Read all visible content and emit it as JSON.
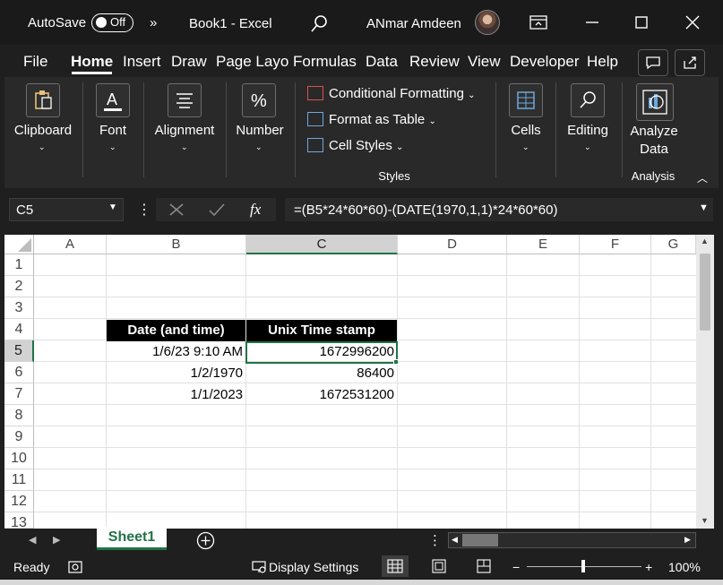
{
  "titlebar": {
    "autosave_label": "AutoSave",
    "autosave_state": "Off",
    "more_glyph": "»",
    "doc_title": "Book1  -  Excel",
    "user_name": "ANmar Amdeen"
  },
  "menu": {
    "tabs": [
      "File",
      "Home",
      "Insert",
      "Draw",
      "Page Layo",
      "Formulas",
      "Data",
      "Review",
      "View",
      "Developer",
      "Help"
    ],
    "active_tab": "Home"
  },
  "ribbon": {
    "clipboard": "Clipboard",
    "font": "Font",
    "alignment": "Alignment",
    "number": "Number",
    "cond_format": "Conditional Formatting",
    "format_table": "Format as Table",
    "cell_styles": "Cell Styles",
    "styles_group": "Styles",
    "cells": "Cells",
    "editing": "Editing",
    "analyze_1": "Analyze",
    "analyze_2": "Data",
    "analysis_group": "Analysis"
  },
  "formula_bar": {
    "name_box": "C5",
    "fx": "fx",
    "formula": "=(B5*24*60*60)-(DATE(1970,1,1)*24*60*60)"
  },
  "grid": {
    "columns": [
      "A",
      "B",
      "C",
      "D",
      "E",
      "F",
      "G"
    ],
    "rows": [
      "1",
      "2",
      "3",
      "4",
      "5",
      "6",
      "7",
      "8",
      "9",
      "10",
      "11",
      "12",
      "13"
    ],
    "header_b": "Date (and time)",
    "header_c": "Unix Time stamp",
    "data": [
      {
        "b": "1/6/23 9:10 AM",
        "c": "1672996200"
      },
      {
        "b": "1/2/1970",
        "c": "86400"
      },
      {
        "b": "1/1/2023",
        "c": "1672531200"
      }
    ],
    "selected_cell": "C5"
  },
  "sheets": {
    "active": "Sheet1"
  },
  "status": {
    "ready": "Ready",
    "display_settings": "Display Settings",
    "zoom": "100%",
    "zoom_minus": "−",
    "zoom_plus": "+"
  },
  "colors": {
    "accent": "#217346",
    "ribbon_bg": "#292929",
    "title_bg": "#1a1a1a"
  }
}
